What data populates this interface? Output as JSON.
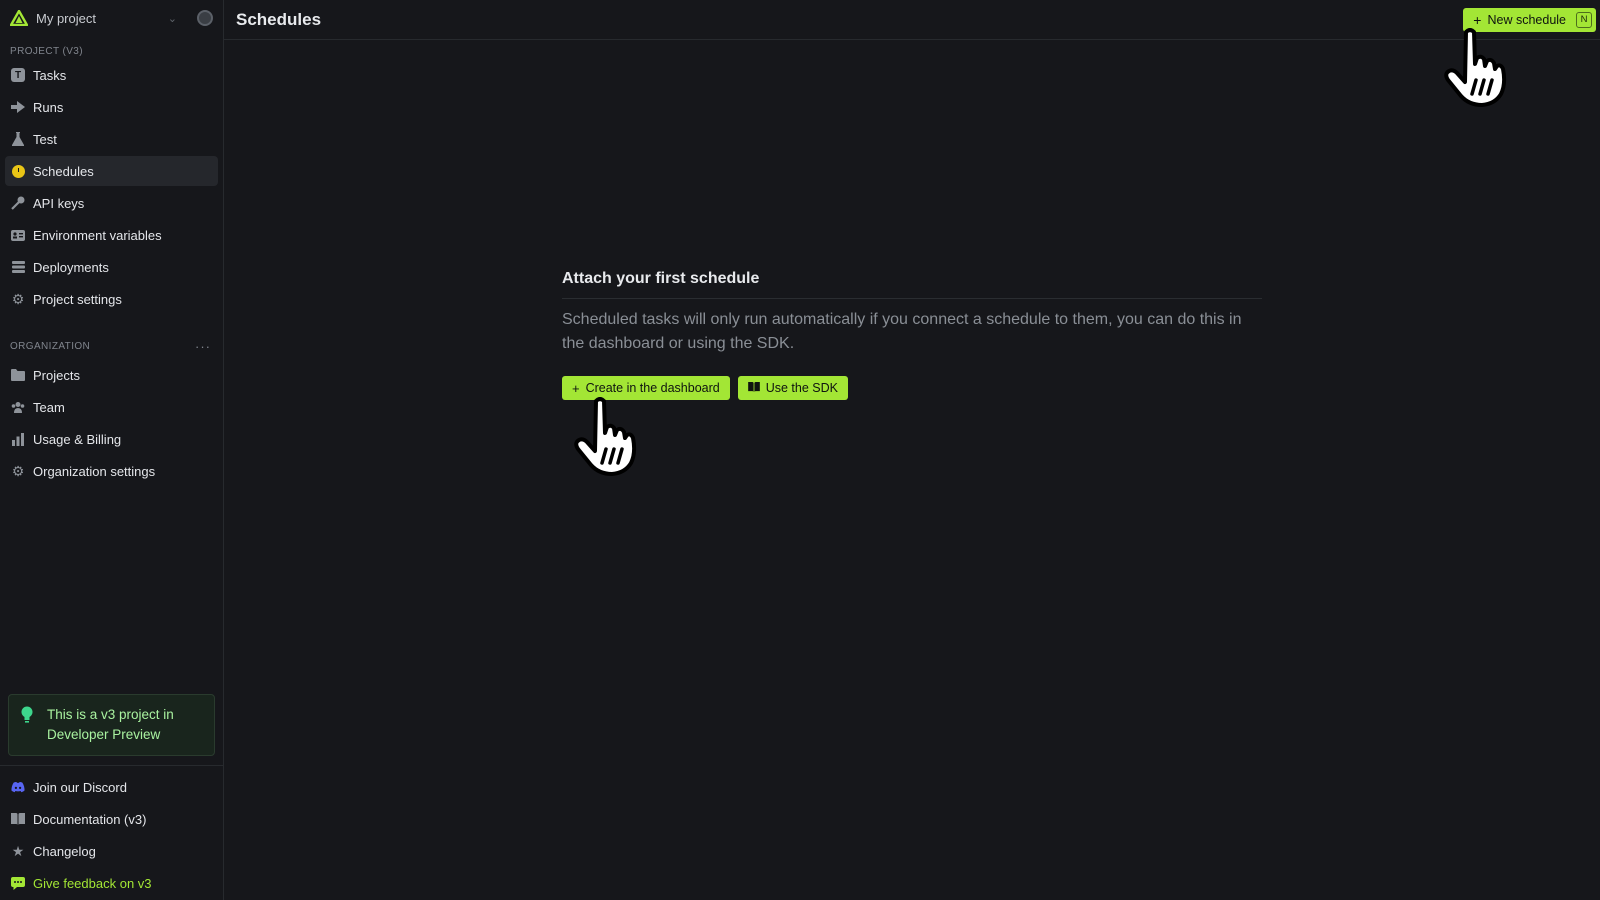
{
  "project": {
    "name": "My project",
    "avatar_icon": "user-circle-icon",
    "chevron_icon": "chevron-down-icon"
  },
  "sidebar": {
    "project_section_label": "PROJECT (V3)",
    "project_items": [
      {
        "label": "Tasks",
        "icon": "task-icon"
      },
      {
        "label": "Runs",
        "icon": "runs-icon"
      },
      {
        "label": "Test",
        "icon": "beaker-icon"
      },
      {
        "label": "Schedules",
        "icon": "clock-icon",
        "active": true
      },
      {
        "label": "API keys",
        "icon": "key-icon"
      },
      {
        "label": "Environment variables",
        "icon": "id-card-icon"
      },
      {
        "label": "Deployments",
        "icon": "stack-icon"
      },
      {
        "label": "Project settings",
        "icon": "gear-icon"
      }
    ],
    "org_section_label": "ORGANIZATION",
    "org_items": [
      {
        "label": "Projects",
        "icon": "folder-icon"
      },
      {
        "label": "Team",
        "icon": "team-icon"
      },
      {
        "label": "Usage & Billing",
        "icon": "bar-chart-icon"
      },
      {
        "label": "Organization settings",
        "icon": "gear-icon"
      }
    ],
    "preview_notice": "This is a v3 project in Developer Preview",
    "bottom_items": [
      {
        "label": "Join our Discord",
        "icon": "discord-icon"
      },
      {
        "label": "Documentation (v3)",
        "icon": "book-icon"
      },
      {
        "label": "Changelog",
        "icon": "star-icon"
      },
      {
        "label": "Give feedback on v3",
        "icon": "chat-icon"
      }
    ]
  },
  "header": {
    "title": "Schedules",
    "new_button_label": "New schedule",
    "new_button_shortcut": "N"
  },
  "empty_state": {
    "title": "Attach your first schedule",
    "description": "Scheduled tasks will only run automatically if you connect a schedule to them, you can do this in the dashboard or using the SDK.",
    "create_button_label": "Create in the dashboard",
    "sdk_button_label": "Use the SDK"
  },
  "colors": {
    "accent": "#a3e635",
    "background": "#16171b",
    "schedules_icon": "#e9c516",
    "discord": "#5865f2"
  }
}
